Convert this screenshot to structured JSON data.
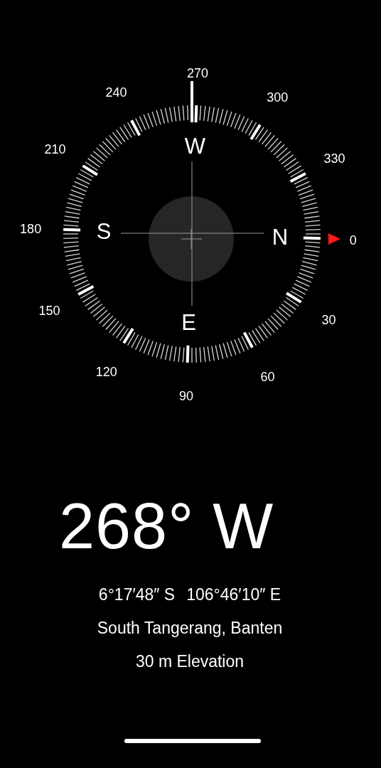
{
  "dial": {
    "degree_labels": [
      "0",
      "30",
      "60",
      "90",
      "120",
      "150",
      "180",
      "210",
      "240",
      "270",
      "300",
      "330"
    ],
    "cardinals": [
      "N",
      "E",
      "S",
      "W"
    ]
  },
  "heading": "268° W",
  "coordinates": {
    "latitude": "6°17′48″ S",
    "longitude": "106°46′10″ E"
  },
  "location": "South Tangerang, Banten",
  "elevation": "30 m Elevation"
}
